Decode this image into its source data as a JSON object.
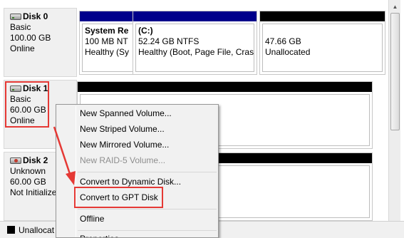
{
  "disks": [
    {
      "name": "Disk 0",
      "type": "Basic",
      "size": "100.00 GB",
      "status": "Online"
    },
    {
      "name": "Disk 1",
      "type": "Basic",
      "size": "60.00 GB",
      "status": "Online"
    },
    {
      "name": "Disk 2",
      "type": "Unknown",
      "size": "60.00 GB",
      "status": "Not Initialize"
    }
  ],
  "disk0_partitions": [
    {
      "name": "System Re",
      "line2": "100 MB NT",
      "line3": "Healthy (Sy"
    },
    {
      "name": "(C:)",
      "line2": "52.24 GB NTFS",
      "line3": "Healthy (Boot, Page File, Crash"
    },
    {
      "name": "",
      "line2": "47.66 GB",
      "line3": "Unallocated"
    }
  ],
  "context_menu": {
    "items": [
      {
        "label": "New Spanned Volume...",
        "enabled": true
      },
      {
        "label": "New Striped Volume...",
        "enabled": true
      },
      {
        "label": "New Mirrored Volume...",
        "enabled": true
      },
      {
        "label": "New RAID-5 Volume...",
        "enabled": false
      },
      {
        "label": "Convert to Dynamic Disk...",
        "enabled": true
      },
      {
        "label": "Convert to GPT Disk",
        "enabled": true
      },
      {
        "label": "Offline",
        "enabled": true
      },
      {
        "label": "Properties",
        "enabled": true
      }
    ]
  },
  "legend": {
    "unallocated_label": "Unallocat"
  },
  "colors": {
    "primary_partition_bar": "#00008b",
    "unallocated_bar": "#000000",
    "highlight_red": "#e53935"
  }
}
